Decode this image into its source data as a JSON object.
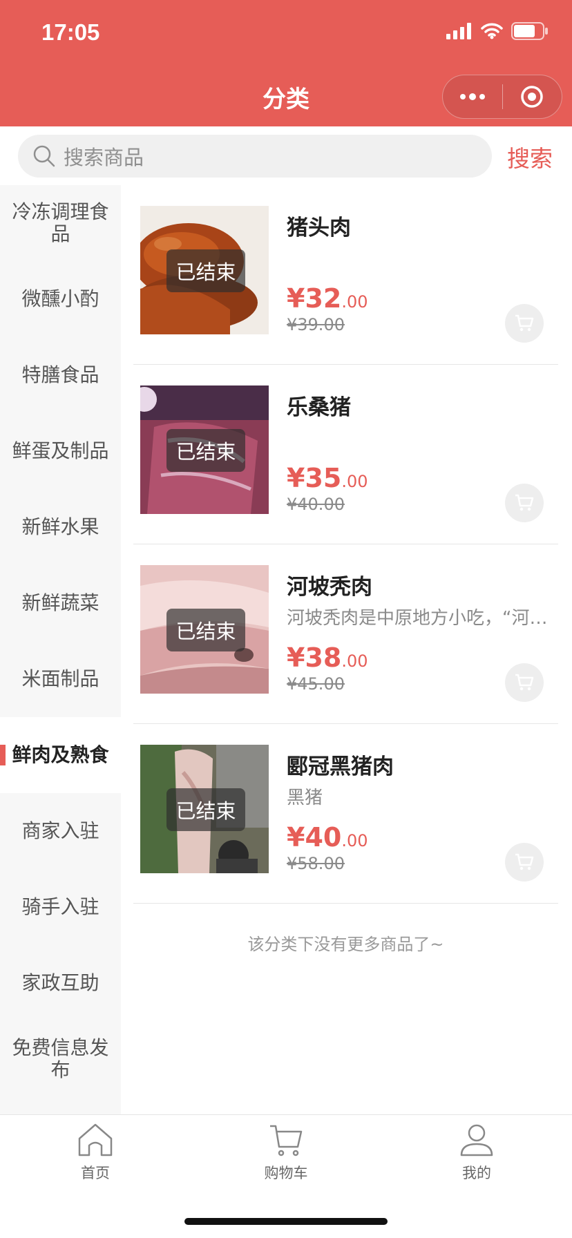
{
  "status_bar": {
    "time": "17:05"
  },
  "header": {
    "title": "分类"
  },
  "search": {
    "placeholder": "搜索商品",
    "button_label": "搜索"
  },
  "categories": [
    {
      "label": "冷冻调理食品",
      "active": false
    },
    {
      "label": "微醺小酌",
      "active": false
    },
    {
      "label": "特膳食品",
      "active": false
    },
    {
      "label": "鲜蛋及制品",
      "active": false
    },
    {
      "label": "新鲜水果",
      "active": false
    },
    {
      "label": "新鲜蔬菜",
      "active": false
    },
    {
      "label": "米面制品",
      "active": false
    },
    {
      "label": "鲜肉及熟食",
      "active": true
    },
    {
      "label": "商家入驻",
      "active": false
    },
    {
      "label": "骑手入驻",
      "active": false
    },
    {
      "label": "家政互助",
      "active": false
    },
    {
      "label": "免费信息发布",
      "active": false
    }
  ],
  "products": [
    {
      "name": "猪头肉",
      "desc": "",
      "price_int": "¥32",
      "price_dec": ".00",
      "original_price": "¥39.00",
      "status": "已结束"
    },
    {
      "name": "乐桑猪",
      "desc": "",
      "price_int": "¥35",
      "price_dec": ".00",
      "original_price": "¥40.00",
      "status": "已结束"
    },
    {
      "name": "河坡秃肉",
      "desc": "河坡秃肉是中原地方小吃，“河坡秃肉”是...",
      "price_int": "¥38",
      "price_dec": ".00",
      "original_price": "¥45.00",
      "status": "已结束"
    },
    {
      "name": "郾冠黑猪肉",
      "desc": "黑猪",
      "price_int": "¥40",
      "price_dec": ".00",
      "original_price": "¥58.00",
      "status": "已结束"
    }
  ],
  "list_end_text": "该分类下没有更多商品了~",
  "tabbar": {
    "home_label": "首页",
    "cart_label": "购物车",
    "mine_label": "我的"
  },
  "colors": {
    "brand": "#e65d57",
    "sidebar_bg": "#f7f7f7"
  }
}
